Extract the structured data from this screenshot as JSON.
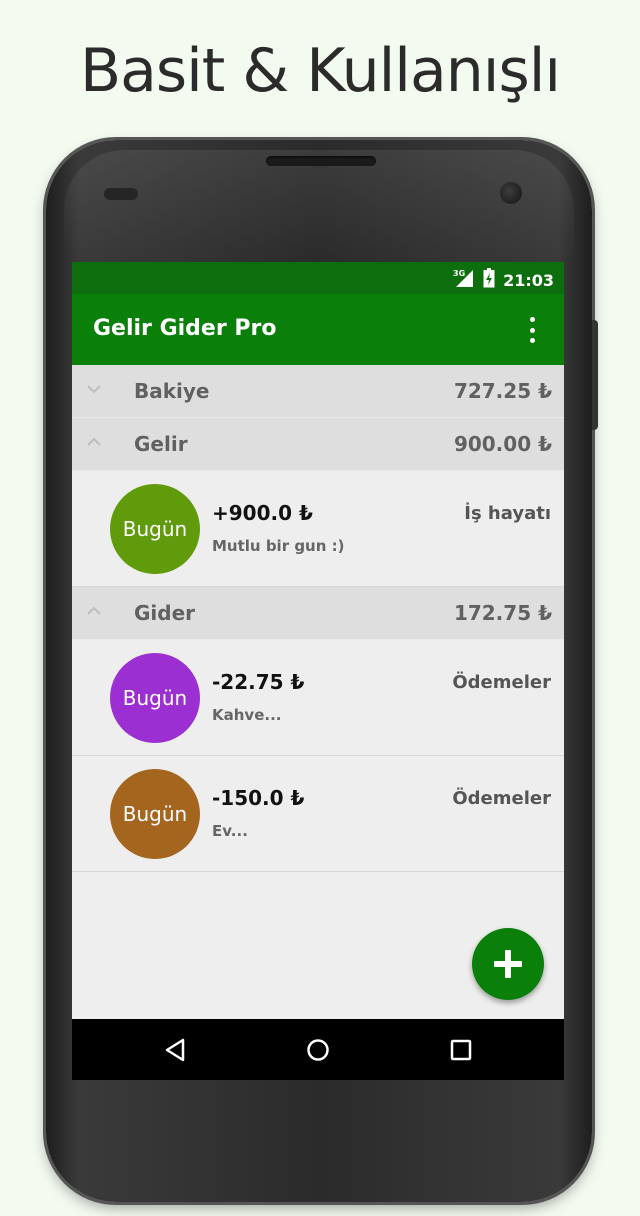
{
  "headline": "Basit & Kullanışlı",
  "status_bar": {
    "network": "3G",
    "time": "21:03"
  },
  "app_bar": {
    "title": "Gelir Gider Pro",
    "menu_icon": "overflow-menu-icon"
  },
  "sections": {
    "balance": {
      "label": "Bakiye",
      "amount": "727.25 ₺",
      "expanded": false
    },
    "income": {
      "label": "Gelir",
      "amount": "900.00 ₺",
      "expanded": true
    },
    "expense": {
      "label": "Gider",
      "amount": "172.75 ₺",
      "expanded": true
    }
  },
  "income_entries": [
    {
      "date": "Bugün",
      "amount": "+900.0 ₺",
      "description": "Mutlu bir gun :)",
      "category": "İş hayatı",
      "color": "#5f9b0a"
    }
  ],
  "expense_entries": [
    {
      "date": "Bugün",
      "amount": "-22.75 ₺",
      "description": "Kahve...",
      "category": "Ödemeler",
      "color": "#9c2fd2"
    },
    {
      "date": "Bugün",
      "amount": "-150.0 ₺",
      "description": "Ev...",
      "category": "Ödemeler",
      "color": "#a4651f"
    }
  ],
  "fab": {
    "icon": "plus-icon"
  },
  "colors": {
    "primary": "#0a7f0a",
    "primary_dark": "#0c6e0c",
    "section_bg": "#dedede",
    "list_bg": "#eeeeee"
  }
}
